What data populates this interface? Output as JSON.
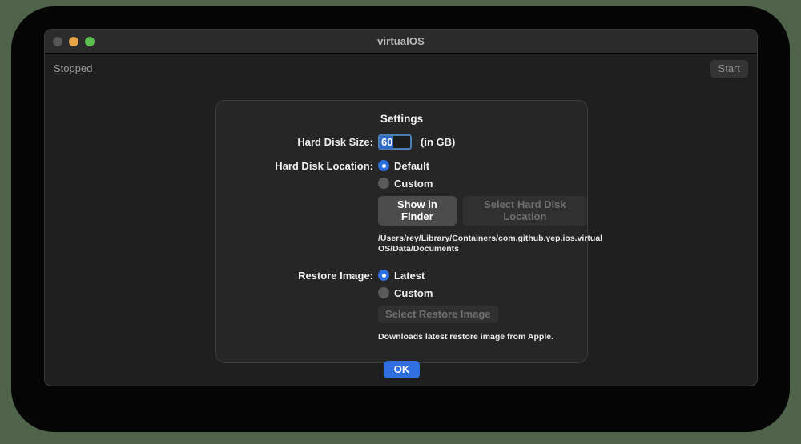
{
  "window": {
    "title": "virtualOS",
    "traffic_lights": [
      "close",
      "minimize",
      "maximize"
    ],
    "status": "Stopped",
    "start_label": "Start"
  },
  "dialog": {
    "title": "Settings",
    "hard_disk_size": {
      "label": "Hard Disk Size:",
      "value": "60",
      "unit": "(in GB)"
    },
    "hard_disk_location": {
      "label": "Hard Disk Location:",
      "options": [
        {
          "label": "Default",
          "selected": true
        },
        {
          "label": "Custom",
          "selected": false
        }
      ],
      "show_in_finder_label": "Show in Finder",
      "select_location_label": "Select Hard Disk Location",
      "path": "/Users/rey/Library/Containers/com.github.yep.ios.virtualOS/Data/Documents"
    },
    "restore_image": {
      "label": "Restore Image:",
      "options": [
        {
          "label": "Latest",
          "selected": true
        },
        {
          "label": "Custom",
          "selected": false
        }
      ],
      "select_restore_label": "Select Restore Image",
      "hint": "Downloads latest restore image from Apple."
    },
    "ok_label": "OK"
  },
  "colors": {
    "accent": "#2f6fe0",
    "desktop": "#4e6349",
    "window_bg": "#1f1f1f",
    "dialog_bg": "#262626"
  }
}
